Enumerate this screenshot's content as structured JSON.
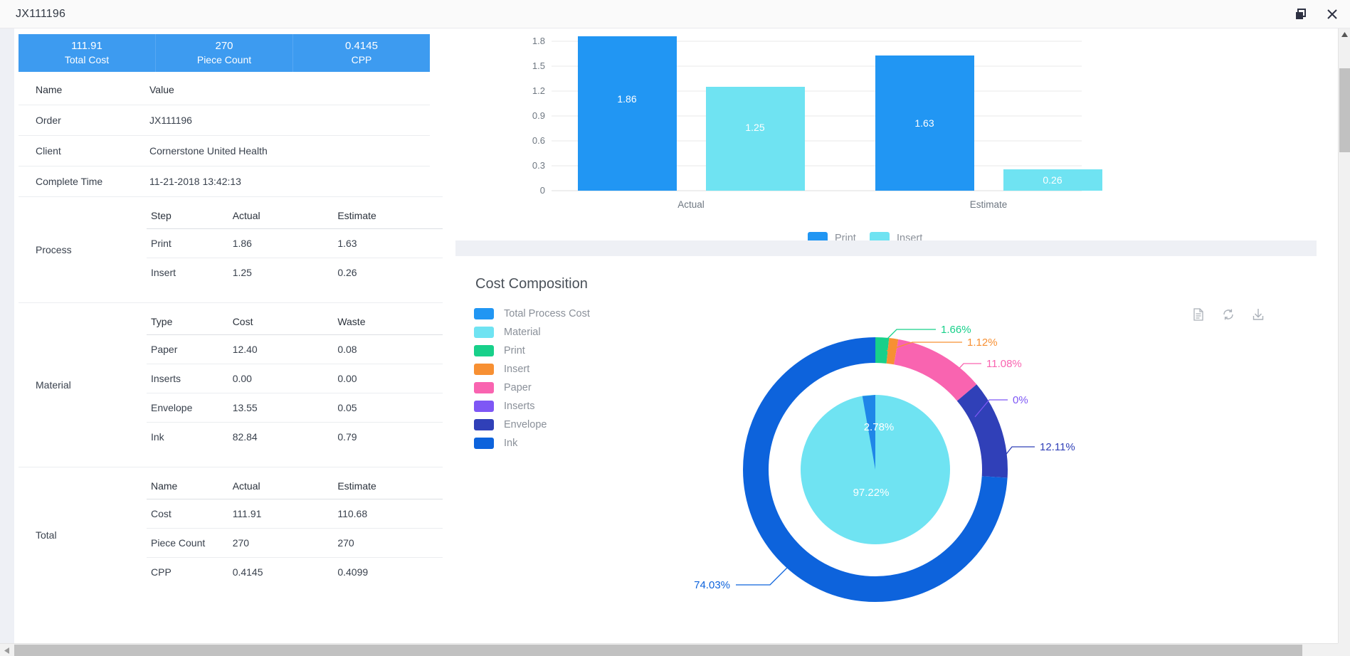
{
  "window": {
    "title": "JX111196",
    "restore_label": "restore-window",
    "close_label": "close-window"
  },
  "summary": {
    "stats": [
      {
        "value": "111.91",
        "label": "Total Cost"
      },
      {
        "value": "270",
        "label": "Piece Count"
      },
      {
        "value": "0.4145",
        "label": "CPP"
      }
    ]
  },
  "details": {
    "headers": {
      "name": "Name",
      "value": "Value"
    },
    "rows": [
      {
        "name": "Order",
        "value": "JX111196"
      },
      {
        "name": "Client",
        "value": "Cornerstone United Health"
      },
      {
        "name": "Complete Time",
        "value": "11-21-2018 13:42:13"
      }
    ],
    "process": {
      "label": "Process",
      "headers": [
        "Step",
        "Actual",
        "Estimate"
      ],
      "rows": [
        [
          "Print",
          "1.86",
          "1.63"
        ],
        [
          "Insert",
          "1.25",
          "0.26"
        ]
      ]
    },
    "material": {
      "label": "Material",
      "headers": [
        "Type",
        "Cost",
        "Waste"
      ],
      "rows": [
        [
          "Paper",
          "12.40",
          "0.08"
        ],
        [
          "Inserts",
          "0.00",
          "0.00"
        ],
        [
          "Envelope",
          "13.55",
          "0.05"
        ],
        [
          "Ink",
          "82.84",
          "0.79"
        ]
      ]
    },
    "total": {
      "label": "Total",
      "headers": [
        "Name",
        "Actual",
        "Estimate"
      ],
      "rows": [
        [
          "Cost",
          "111.91",
          "110.68"
        ],
        [
          "Piece Count",
          "270",
          "270"
        ],
        [
          "CPP",
          "0.4145",
          "0.4099"
        ]
      ]
    }
  },
  "cost_composition": {
    "title": "Cost Composition",
    "legend": [
      {
        "label": "Total Process Cost",
        "color": "#2196F3"
      },
      {
        "label": "Material",
        "color": "#6FE3F2"
      },
      {
        "label": "Print",
        "color": "#18D08A"
      },
      {
        "label": "Insert",
        "color": "#F79033"
      },
      {
        "label": "Paper",
        "color": "#F964B0"
      },
      {
        "label": "Inserts",
        "color": "#7E57F5"
      },
      {
        "label": "Envelope",
        "color": "#3040B8"
      },
      {
        "label": "Ink",
        "color": "#0D63DC"
      }
    ],
    "toolbar": [
      {
        "name": "data-view-icon",
        "title": "Data View"
      },
      {
        "name": "refresh-icon",
        "title": "Restore"
      },
      {
        "name": "download-icon",
        "title": "Save as Image"
      }
    ]
  },
  "chart_data": [
    {
      "type": "bar",
      "title": "",
      "categories": [
        "Actual",
        "Estimate"
      ],
      "series": [
        {
          "name": "Print",
          "color": "#2196F3",
          "values": [
            1.86,
            1.63
          ]
        },
        {
          "name": "Insert",
          "color": "#6FE3F2",
          "values": [
            1.25,
            0.26
          ]
        }
      ],
      "ytick_labels": [
        "0",
        "0.3",
        "0.6",
        "0.9",
        "1.2",
        "1.5",
        "1.8"
      ],
      "ylim": [
        0,
        1.8
      ],
      "xlabel": "",
      "ylabel": "",
      "grid": true,
      "legend_position": "bottom",
      "data_labels": [
        "1.86",
        "1.25",
        "1.63",
        "0.26"
      ]
    },
    {
      "type": "pie",
      "title": "Cost Composition",
      "rings": [
        {
          "name": "inner",
          "labels": [
            "Total Process Cost",
            "Material"
          ],
          "values": [
            2.78,
            97.22
          ],
          "value_labels": [
            "2.78%",
            "97.22%"
          ],
          "colors": [
            "#1F86E8",
            "#6FE3F2"
          ]
        },
        {
          "name": "outer",
          "labels": [
            "Print",
            "Insert",
            "Paper",
            "Inserts",
            "Envelope",
            "Ink"
          ],
          "values": [
            1.66,
            1.12,
            11.08,
            0,
            12.11,
            74.03
          ],
          "value_labels": [
            "1.66%",
            "1.12%",
            "11.08%",
            "0%",
            "12.11%",
            "74.03%"
          ],
          "colors": [
            "#18D08A",
            "#F79033",
            "#F964B0",
            "#7E57F5",
            "#3040B8",
            "#0D63DC"
          ]
        }
      ],
      "legend_position": "left"
    }
  ]
}
